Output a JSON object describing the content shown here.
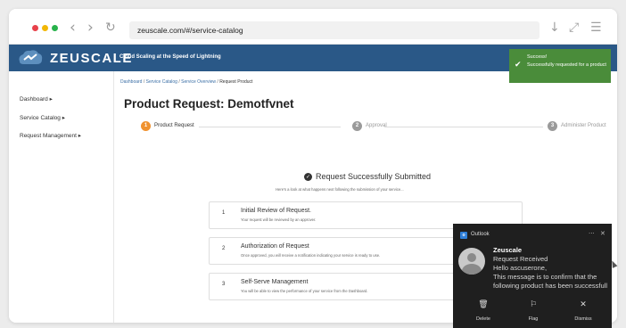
{
  "browser": {
    "url": "zeuscale.com/#/service-catalog",
    "back_icon": "chevron-left-icon",
    "forward_icon": "chevron-right-icon",
    "reload_icon": "reload-icon",
    "colors": {
      "close": "#e8414a",
      "minimize": "#f2b705",
      "maximize": "#28b24b"
    }
  },
  "header": {
    "logo_text": "ZEUSCALE",
    "tagline": "Cloud Scaling at the Speed of Lightning",
    "color": "#2a5887"
  },
  "sidebar": {
    "items": [
      {
        "label": "Dashboard ▸"
      },
      {
        "label": "Service Catalog ▸"
      },
      {
        "label": "Request Management ▸"
      }
    ]
  },
  "breadcrumb": {
    "items": [
      "Dashboard",
      "Service Catalog",
      "Service Overview",
      "Request Product"
    ],
    "separator": " / "
  },
  "page": {
    "title": "Product Request: Demotfvnet"
  },
  "steps": [
    {
      "num": "1",
      "label": "Product Request",
      "color": "#f0922f"
    },
    {
      "num": "2",
      "label": "Approval",
      "color": "#9a9a9a"
    },
    {
      "num": "3",
      "label": "Administer Product",
      "color": "#9a9a9a"
    }
  ],
  "success": {
    "title": "Request Successfully Submitted",
    "subtitle": "Here's a look at what happens next following the submission of your service..."
  },
  "cards": [
    {
      "num": "1",
      "title": "Initial Review of Request.",
      "desc": "Your request will be reviewed by an approver."
    },
    {
      "num": "2",
      "title": "Authorization of Request",
      "desc": "Once approved, you will receive a notification indicating your service is ready to use."
    },
    {
      "num": "3",
      "title": "Self-Serve Management",
      "desc": "You will be able to view the performance of your service from the Dashboard."
    }
  ],
  "toast": {
    "title": "Success!",
    "message": "Successfully requested for a product",
    "color": "#4a8c3a"
  },
  "outlook": {
    "app": "Outlook",
    "sender": "Zeuscale",
    "lines": [
      "Request Received",
      "Hello ascuserone,",
      "This message is to confirm that the",
      "following product has been successfull"
    ],
    "actions": [
      {
        "label": "Delete",
        "icon": "trash-icon"
      },
      {
        "label": "Flag",
        "icon": "flag-icon"
      },
      {
        "label": "Dismiss",
        "icon": "close-icon"
      }
    ]
  }
}
